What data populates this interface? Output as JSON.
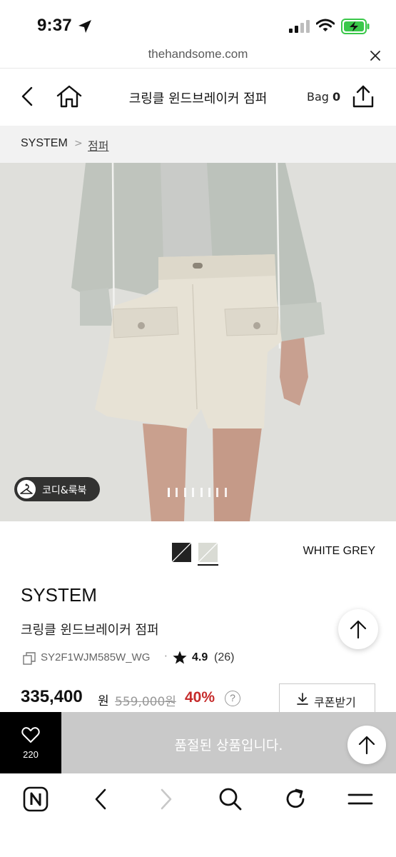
{
  "status_bar": {
    "time": "9:37"
  },
  "browser": {
    "url": "thehandsome.com"
  },
  "header": {
    "title": "크링클 윈드브레이커 점퍼",
    "bag_label": "Bag",
    "bag_count": "0"
  },
  "breadcrumb": {
    "brand": "SYSTEM",
    "separator": ">",
    "category": "점퍼"
  },
  "gallery": {
    "codi_button": "코디&룩북",
    "slide_count": 8,
    "active_slide": 1
  },
  "colors": {
    "options": [
      {
        "name": "black",
        "hex": "#222222"
      },
      {
        "name": "white-grey",
        "hex": "#d9dbd4"
      }
    ],
    "selected_name": "WHITE GREY"
  },
  "product": {
    "brand": "SYSTEM",
    "name": "크링클 윈드브레이커 점퍼",
    "code": "SY2F1WJM585W_WG",
    "meta_separator": "·",
    "rating": "4.9",
    "reviews": "(26)",
    "sale_price": "335,400",
    "currency": "원",
    "original_price": "559,000원",
    "discount": "40%",
    "help": "?",
    "coupon_label": "쿠폰받기"
  },
  "action_bar": {
    "wish_count": "220",
    "soldout_label": "품절된 상품입니다."
  },
  "accent_colors": {
    "discount": "#c62b2b",
    "soldout_bg": "#c9c9c9",
    "battery": "#3ac84a"
  }
}
